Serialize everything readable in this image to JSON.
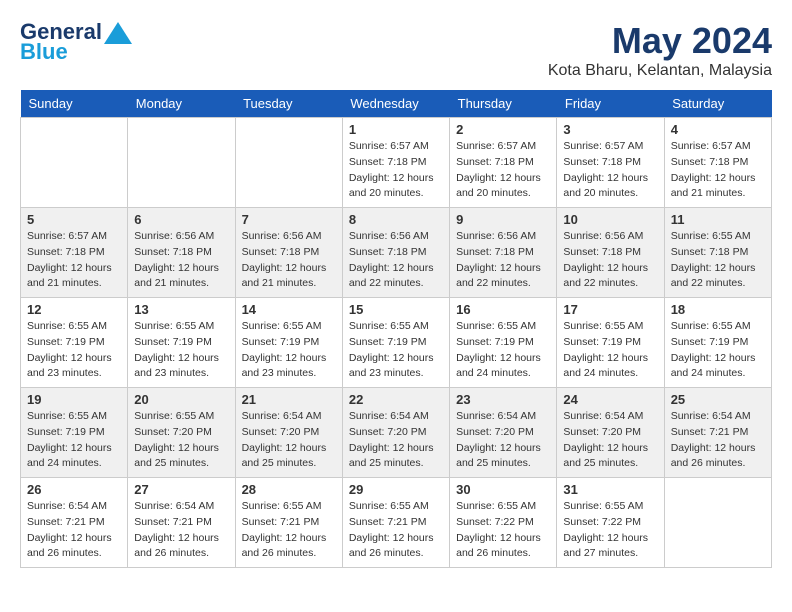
{
  "header": {
    "logo_line1": "General",
    "logo_line2": "Blue",
    "month_title": "May 2024",
    "location": "Kota Bharu, Kelantan, Malaysia"
  },
  "weekdays": [
    "Sunday",
    "Monday",
    "Tuesday",
    "Wednesday",
    "Thursday",
    "Friday",
    "Saturday"
  ],
  "weeks": [
    [
      {
        "day": "",
        "info": ""
      },
      {
        "day": "",
        "info": ""
      },
      {
        "day": "",
        "info": ""
      },
      {
        "day": "1",
        "info": "Sunrise: 6:57 AM\nSunset: 7:18 PM\nDaylight: 12 hours\nand 20 minutes."
      },
      {
        "day": "2",
        "info": "Sunrise: 6:57 AM\nSunset: 7:18 PM\nDaylight: 12 hours\nand 20 minutes."
      },
      {
        "day": "3",
        "info": "Sunrise: 6:57 AM\nSunset: 7:18 PM\nDaylight: 12 hours\nand 20 minutes."
      },
      {
        "day": "4",
        "info": "Sunrise: 6:57 AM\nSunset: 7:18 PM\nDaylight: 12 hours\nand 21 minutes."
      }
    ],
    [
      {
        "day": "5",
        "info": "Sunrise: 6:57 AM\nSunset: 7:18 PM\nDaylight: 12 hours\nand 21 minutes."
      },
      {
        "day": "6",
        "info": "Sunrise: 6:56 AM\nSunset: 7:18 PM\nDaylight: 12 hours\nand 21 minutes."
      },
      {
        "day": "7",
        "info": "Sunrise: 6:56 AM\nSunset: 7:18 PM\nDaylight: 12 hours\nand 21 minutes."
      },
      {
        "day": "8",
        "info": "Sunrise: 6:56 AM\nSunset: 7:18 PM\nDaylight: 12 hours\nand 22 minutes."
      },
      {
        "day": "9",
        "info": "Sunrise: 6:56 AM\nSunset: 7:18 PM\nDaylight: 12 hours\nand 22 minutes."
      },
      {
        "day": "10",
        "info": "Sunrise: 6:56 AM\nSunset: 7:18 PM\nDaylight: 12 hours\nand 22 minutes."
      },
      {
        "day": "11",
        "info": "Sunrise: 6:55 AM\nSunset: 7:18 PM\nDaylight: 12 hours\nand 22 minutes."
      }
    ],
    [
      {
        "day": "12",
        "info": "Sunrise: 6:55 AM\nSunset: 7:19 PM\nDaylight: 12 hours\nand 23 minutes."
      },
      {
        "day": "13",
        "info": "Sunrise: 6:55 AM\nSunset: 7:19 PM\nDaylight: 12 hours\nand 23 minutes."
      },
      {
        "day": "14",
        "info": "Sunrise: 6:55 AM\nSunset: 7:19 PM\nDaylight: 12 hours\nand 23 minutes."
      },
      {
        "day": "15",
        "info": "Sunrise: 6:55 AM\nSunset: 7:19 PM\nDaylight: 12 hours\nand 23 minutes."
      },
      {
        "day": "16",
        "info": "Sunrise: 6:55 AM\nSunset: 7:19 PM\nDaylight: 12 hours\nand 24 minutes."
      },
      {
        "day": "17",
        "info": "Sunrise: 6:55 AM\nSunset: 7:19 PM\nDaylight: 12 hours\nand 24 minutes."
      },
      {
        "day": "18",
        "info": "Sunrise: 6:55 AM\nSunset: 7:19 PM\nDaylight: 12 hours\nand 24 minutes."
      }
    ],
    [
      {
        "day": "19",
        "info": "Sunrise: 6:55 AM\nSunset: 7:19 PM\nDaylight: 12 hours\nand 24 minutes."
      },
      {
        "day": "20",
        "info": "Sunrise: 6:55 AM\nSunset: 7:20 PM\nDaylight: 12 hours\nand 25 minutes."
      },
      {
        "day": "21",
        "info": "Sunrise: 6:54 AM\nSunset: 7:20 PM\nDaylight: 12 hours\nand 25 minutes."
      },
      {
        "day": "22",
        "info": "Sunrise: 6:54 AM\nSunset: 7:20 PM\nDaylight: 12 hours\nand 25 minutes."
      },
      {
        "day": "23",
        "info": "Sunrise: 6:54 AM\nSunset: 7:20 PM\nDaylight: 12 hours\nand 25 minutes."
      },
      {
        "day": "24",
        "info": "Sunrise: 6:54 AM\nSunset: 7:20 PM\nDaylight: 12 hours\nand 25 minutes."
      },
      {
        "day": "25",
        "info": "Sunrise: 6:54 AM\nSunset: 7:21 PM\nDaylight: 12 hours\nand 26 minutes."
      }
    ],
    [
      {
        "day": "26",
        "info": "Sunrise: 6:54 AM\nSunset: 7:21 PM\nDaylight: 12 hours\nand 26 minutes."
      },
      {
        "day": "27",
        "info": "Sunrise: 6:54 AM\nSunset: 7:21 PM\nDaylight: 12 hours\nand 26 minutes."
      },
      {
        "day": "28",
        "info": "Sunrise: 6:55 AM\nSunset: 7:21 PM\nDaylight: 12 hours\nand 26 minutes."
      },
      {
        "day": "29",
        "info": "Sunrise: 6:55 AM\nSunset: 7:21 PM\nDaylight: 12 hours\nand 26 minutes."
      },
      {
        "day": "30",
        "info": "Sunrise: 6:55 AM\nSunset: 7:22 PM\nDaylight: 12 hours\nand 26 minutes."
      },
      {
        "day": "31",
        "info": "Sunrise: 6:55 AM\nSunset: 7:22 PM\nDaylight: 12 hours\nand 27 minutes."
      },
      {
        "day": "",
        "info": ""
      }
    ]
  ]
}
